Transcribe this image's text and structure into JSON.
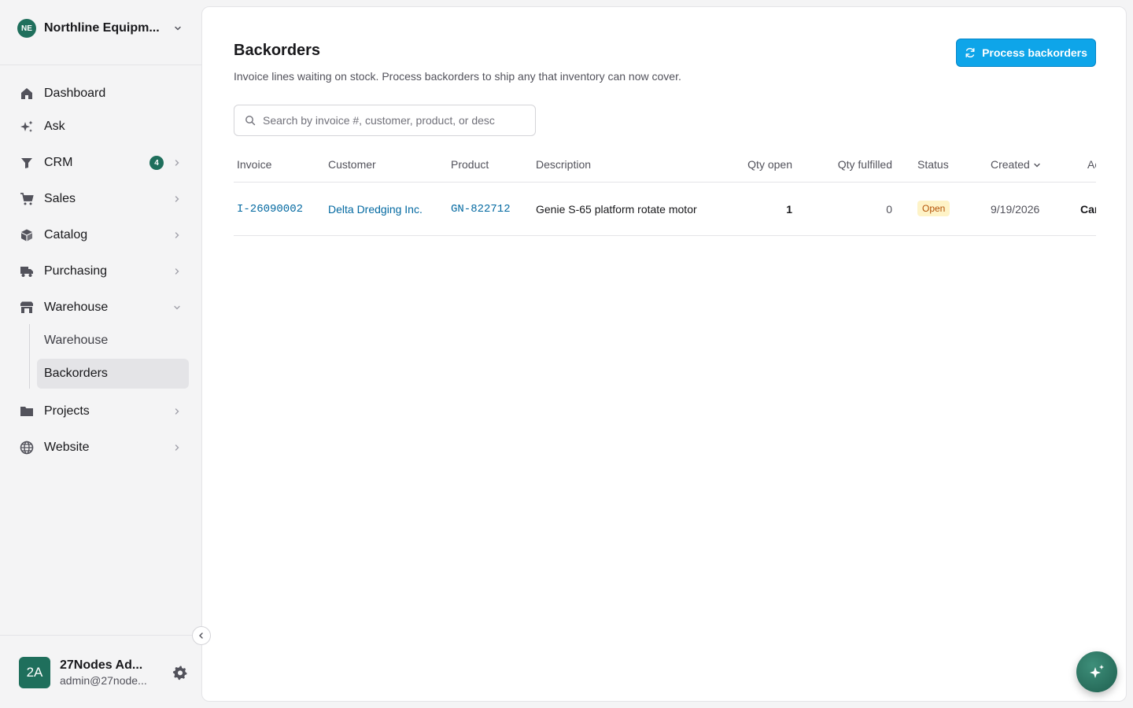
{
  "org": {
    "initials": "NE",
    "name": "Northline Equipm..."
  },
  "nav": {
    "dashboard": "Dashboard",
    "ask": "Ask",
    "crm": "CRM",
    "crm_badge": "4",
    "sales": "Sales",
    "catalog": "Catalog",
    "purchasing": "Purchasing",
    "warehouse": "Warehouse",
    "warehouse_sub": [
      "Warehouse",
      "Backorders"
    ],
    "projects": "Projects",
    "website": "Website"
  },
  "user": {
    "initials": "2A",
    "name": "27Nodes Ad...",
    "email": "admin@27node..."
  },
  "page": {
    "title": "Backorders",
    "subtitle": "Invoice lines waiting on stock. Process backorders to ship any that inventory can now cover.",
    "process_button": "Process backorders",
    "search_placeholder": "Search by invoice #, customer, product, or desc"
  },
  "table": {
    "headers": [
      "Invoice",
      "Customer",
      "Product",
      "Description",
      "Qty open",
      "Qty fulfilled",
      "Status",
      "Created",
      "Actions"
    ],
    "rows": [
      {
        "invoice": "I-26090002",
        "customer": "Delta Dredging Inc.",
        "product": "GN-822712",
        "description": "Genie S-65 platform rotate motor",
        "qty_open": "1",
        "qty_fulfilled": "0",
        "status": "Open",
        "created": "9/19/2026",
        "action": "Cancel"
      }
    ]
  },
  "colors": {
    "accent": "#0ea5e9",
    "brand": "#1f6f5c",
    "status_open_bg": "#fef3c7",
    "status_open_text": "#b45309",
    "link": "#0369a1"
  }
}
